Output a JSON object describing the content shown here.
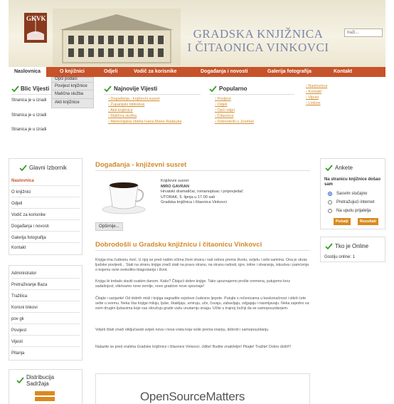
{
  "header": {
    "logo_text": "GKVK",
    "title_line1": "GRADSKA KNJIŽNICA",
    "title_line2": "I ČITAONICA VINKOVCI",
    "search_value": "traži..."
  },
  "nav": {
    "items": [
      "Naslovnica",
      "O knjižnici",
      "Odjeli",
      "Vodič za korisnike",
      "Događanja i novosti",
      "Galerija fotografija",
      "Kontakt"
    ]
  },
  "dropdown": {
    "items": [
      "Opći podaci",
      "Povijest knjižnice",
      "Matična služba",
      "Akti knjižnice"
    ]
  },
  "modules": {
    "blic": {
      "title": "Blic Vijesti",
      "items": [
        "Stranica je u izradi",
        "Stranica je u izradi",
        "Stranica je u izradi"
      ]
    },
    "najnovije": {
      "title": "Najnovije Vijesti",
      "items": [
        "Događanja - književni susret",
        "Županijski bibliobus",
        "Akti knjižnice",
        "Matična služba",
        "Memorijalna zbirka Ivana Mane Radauša"
      ]
    },
    "popularno": {
      "title": "Popularno",
      "items": [
        "Povijest",
        "Odjeli",
        "Opći odjel",
        "Čitaonica",
        "Dobrodošli u Joomla!"
      ]
    },
    "links": {
      "items": [
        "Naslovnica",
        "Kontakt",
        "Vijesti",
        "Linkovi"
      ]
    }
  },
  "left": {
    "main_menu_title": "Glavni Izbornik",
    "main_menu": [
      "Naslovnica",
      "O knjižnici",
      "Odjeli",
      "Vodič za korisnike",
      "Događanja i novosti",
      "Galerija fotografija",
      "Kontakt"
    ],
    "user_menu": [
      "Administrator",
      "Pretraživanje Baza",
      "Tražilica",
      "Korisni linkovi",
      "pov gk",
      "Povijest",
      "Vijesti",
      "Pitanja"
    ],
    "distribution_title_line1": "Distribucija",
    "distribution_title_line2": "Sadržaja"
  },
  "center": {
    "event_title": "Događanja - književni susret",
    "event_lines": [
      "Književni susret",
      "MIRO GAVRAN",
      "Hrvatski dramatičar, romanopisac i pripovjedač",
      "UTORAK, 5. lipnja u 17.00 sati",
      "Gradska knjižnica i čitaonica Vinkovci"
    ],
    "more_button": "Opširnije...",
    "welcome_title": "Dobrodošli u Gradsku knjižnicu i čitaonicu Vinkovci",
    "paragraphs": [
      "Knjiga ima čudesnu moć. U njoj se pred našim očima život stvara i naš odnos prema životu, svijetu i sebi samima. Ona je ukras ljudske povijesti... Stati na stranu knjige znači stati na pravu stranu, na stranu radosti, igre, istine i stvaranja, iskustva i pamćenja o kojemu ovisi svekoliko blagostanje i život.",
      "Knjigu bi trebalo slaviti svakim danom. Kako? Čitajući dobre knjige. Tako upoznajemo prošle vremena, putujemo kroz sadašnjost, otkrivamo nove zemlje, nove gradove nove spoznaje!",
      "Čitajte i sanjarite! Od dobrih misli i knjiga sagradite svjetove čudesne ljepote. Putujte s rečenicama u beskonačnost i otkrit ćete sebe u svemu. Neka Vas knjige miluju, ljube, škakljaju, umiruju, uče, čuvaju, zabavljaju, odgajaju i nasmijavaju. Neka zajedno sa svim drugim ljubavima koje vas okružuju grade vašu unutarnju snagu. Učite u trajnoj čežnji da se samopouzdanjem.",
      "Voljeti čitati znači otključavati uvijek nova i nova vrata koja vode prema znanju, dobroti i samopouzdanju.",
      "Nalazite se pred vratima Gradske knjižnice i čitaonice Vinkovci. Uđite! Budite znatiželjni! Pitajte! Tražite! Dobro došli!!!"
    ],
    "banner_text": "OpenSourceMatters"
  },
  "right": {
    "poll_title": "Ankete",
    "poll_question": "Na stranicu knjižnice došao sam",
    "poll_options": [
      "Sasvim slučajno",
      "Pretražujući internet",
      "Na uputu prijatelja"
    ],
    "vote_button": "Pošalji",
    "results_button": "Rezultati",
    "online_title": "Tko je Online",
    "online_text": "Gostiju online: 1"
  },
  "colors": {
    "accent": "#c6532a",
    "link": "#d28a2a",
    "check": "#3a9a2a"
  }
}
